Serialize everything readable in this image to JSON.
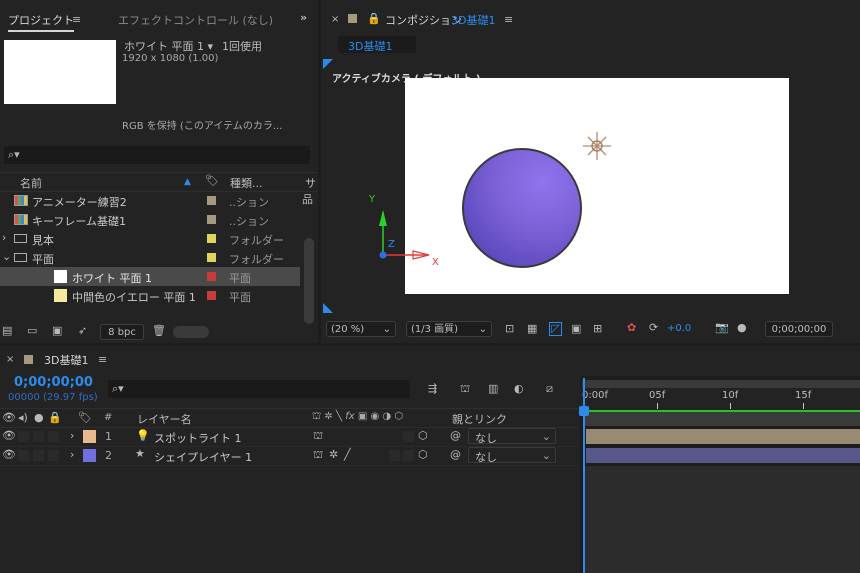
{
  "project_panel": {
    "tab_project": "プロジェクト",
    "tab_effects": "エフェクトコントロール (なし)",
    "item_name": "ホワイト 平面 1 ▾",
    "usage": "1回使用",
    "dimensions": "1920 x 1080 (1.00)",
    "color_note": "RGB を保持 (このアイテムのカラ...",
    "search_placeholder": "",
    "col_name": "名前",
    "col_type": "種類...",
    "col_extra": "サ",
    "rows": [
      {
        "name": "アニメーター練習2",
        "type": "..ション",
        "label_color": "#a59a80",
        "indent": 0,
        "kind": "comp",
        "twirl": ""
      },
      {
        "name": "キーフレーム基礎1",
        "type": "..ション",
        "label_color": "#a59a80",
        "indent": 0,
        "kind": "comp",
        "twirl": ""
      },
      {
        "name": "見本",
        "type": "フォルダー",
        "label_color": "#e0d55d",
        "indent": 0,
        "kind": "folder",
        "twirl": "›"
      },
      {
        "name": "平面",
        "type": "フォルダー",
        "label_color": "#e0d55d",
        "indent": 0,
        "kind": "folder",
        "twirl": "⌄"
      },
      {
        "name": "ホワイト 平面 1",
        "type": "平面",
        "label_color": "#c63b3b",
        "indent": 1,
        "kind": "white",
        "twirl": ""
      },
      {
        "name": "中間色のイエロー 平面 1",
        "type": "平面",
        "label_color": "#c63b3b",
        "indent": 1,
        "kind": "yellow",
        "twirl": ""
      }
    ],
    "bpc": "8 bpc"
  },
  "comp_panel": {
    "tab_prefix": "コンポジション",
    "comp_name": "3D基礎1",
    "subtab": "3D基礎1",
    "camera_label": "アクティブカメラ ( デフォルト )",
    "axis_x": "X",
    "axis_y": "Y",
    "axis_z": "Z",
    "zoom": "(20 %)",
    "resolution": "(1/3 画質)",
    "exposure": "+0.0",
    "timecode": "0;00;00;00",
    "sphere_color": "#7a5fd4"
  },
  "timeline": {
    "tab": "3D基礎1",
    "timecode": "0;00;00;00",
    "frame_info": "00000 (29.97 fps)",
    "col_layer_name": "レイヤー名",
    "col_number": "#",
    "col_parent": "親とリンク",
    "ruler_labels": [
      "0:00f",
      "05f",
      "10f",
      "15f"
    ],
    "layers": [
      {
        "num": "1",
        "name": "スポットライト 1",
        "label_color": "#e8b98c",
        "icon": "light",
        "parent": "なし",
        "bar_color": "#9a8a74"
      },
      {
        "num": "2",
        "name": "シェイプレイヤー 1",
        "label_color": "#6f6fde",
        "icon": "star",
        "parent": "なし",
        "bar_color": "#58598a"
      }
    ]
  }
}
